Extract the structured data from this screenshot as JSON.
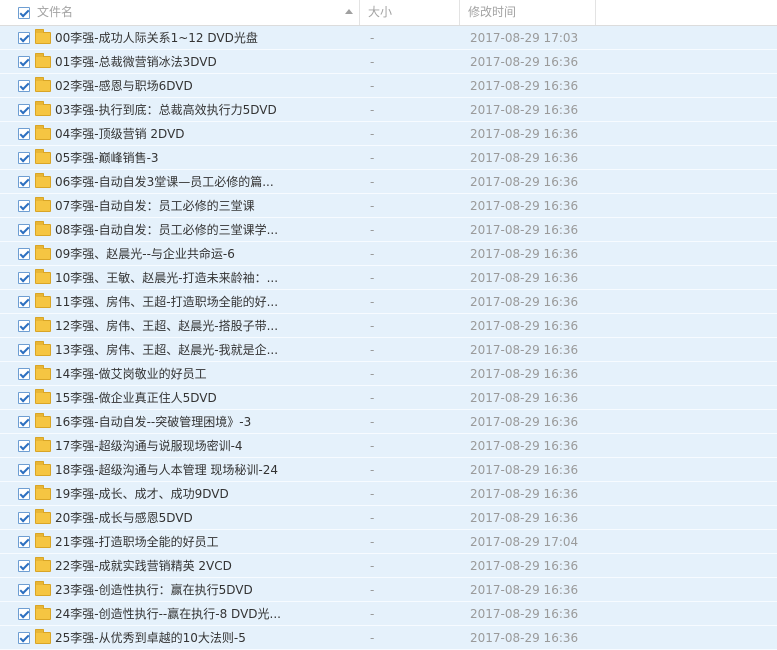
{
  "header": {
    "name_label": "文件名",
    "size_label": "大小",
    "mtime_label": "修改时间"
  },
  "rows": [
    {
      "name": "00李强-成功人际关系1~12 DVD光盘",
      "size": "-",
      "mtime": "2017-08-29 17:03"
    },
    {
      "name": "01李强-总裁微营销冰法3DVD",
      "size": "-",
      "mtime": "2017-08-29 16:36"
    },
    {
      "name": "02李强-感恩与职场6DVD",
      "size": "-",
      "mtime": "2017-08-29 16:36"
    },
    {
      "name": "03李强-执行到底：总裁高效执行力5DVD",
      "size": "-",
      "mtime": "2017-08-29 16:36"
    },
    {
      "name": "04李强-顶级营销 2DVD",
      "size": "-",
      "mtime": "2017-08-29 16:36"
    },
    {
      "name": "05李强-巅峰销售-3",
      "size": "-",
      "mtime": "2017-08-29 16:36"
    },
    {
      "name": "06李强-自动自发3堂课—员工必修的篇...",
      "size": "-",
      "mtime": "2017-08-29 16:36"
    },
    {
      "name": "07李强-自动自发：员工必修的三堂课",
      "size": "-",
      "mtime": "2017-08-29 16:36"
    },
    {
      "name": "08李强-自动自发：员工必修的三堂课学...",
      "size": "-",
      "mtime": "2017-08-29 16:36"
    },
    {
      "name": "09李强、赵晨光--与企业共命运-6",
      "size": "-",
      "mtime": "2017-08-29 16:36"
    },
    {
      "name": "10李强、王敏、赵晨光-打造未来龄袖：...",
      "size": "-",
      "mtime": "2017-08-29 16:36"
    },
    {
      "name": "11李强、房伟、王超-打造职场全能的好...",
      "size": "-",
      "mtime": "2017-08-29 16:36"
    },
    {
      "name": "12李强、房伟、王超、赵晨光-搭股子带...",
      "size": "-",
      "mtime": "2017-08-29 16:36"
    },
    {
      "name": "13李强、房伟、王超、赵晨光-我就是企...",
      "size": "-",
      "mtime": "2017-08-29 16:36"
    },
    {
      "name": "14李强-做艾岗敬业的好员工",
      "size": "-",
      "mtime": "2017-08-29 16:36"
    },
    {
      "name": "15李强-做企业真正住人5DVD",
      "size": "-",
      "mtime": "2017-08-29 16:36"
    },
    {
      "name": "16李强-自动自发--突破管理困境》-3",
      "size": "-",
      "mtime": "2017-08-29 16:36"
    },
    {
      "name": "17李强-超级沟通与说服现场密训-4",
      "size": "-",
      "mtime": "2017-08-29 16:36"
    },
    {
      "name": "18李强-超级沟通与人本管理 现场秘训-24",
      "size": "-",
      "mtime": "2017-08-29 16:36"
    },
    {
      "name": "19李强-成长、成才、成功9DVD",
      "size": "-",
      "mtime": "2017-08-29 16:36"
    },
    {
      "name": "20李强-成长与感恩5DVD",
      "size": "-",
      "mtime": "2017-08-29 16:36"
    },
    {
      "name": "21李强-打造职场全能的好员工",
      "size": "-",
      "mtime": "2017-08-29 17:04"
    },
    {
      "name": "22李强-成就实践营销精英 2VCD",
      "size": "-",
      "mtime": "2017-08-29 16:36"
    },
    {
      "name": "23李强-创造性执行：赢在执行5DVD",
      "size": "-",
      "mtime": "2017-08-29 16:36"
    },
    {
      "name": "24李强-创造性执行--赢在执行-8 DVD光...",
      "size": "-",
      "mtime": "2017-08-29 16:36"
    },
    {
      "name": "25李强-从优秀到卓越的10大法则-5",
      "size": "-",
      "mtime": "2017-08-29 16:36"
    }
  ]
}
